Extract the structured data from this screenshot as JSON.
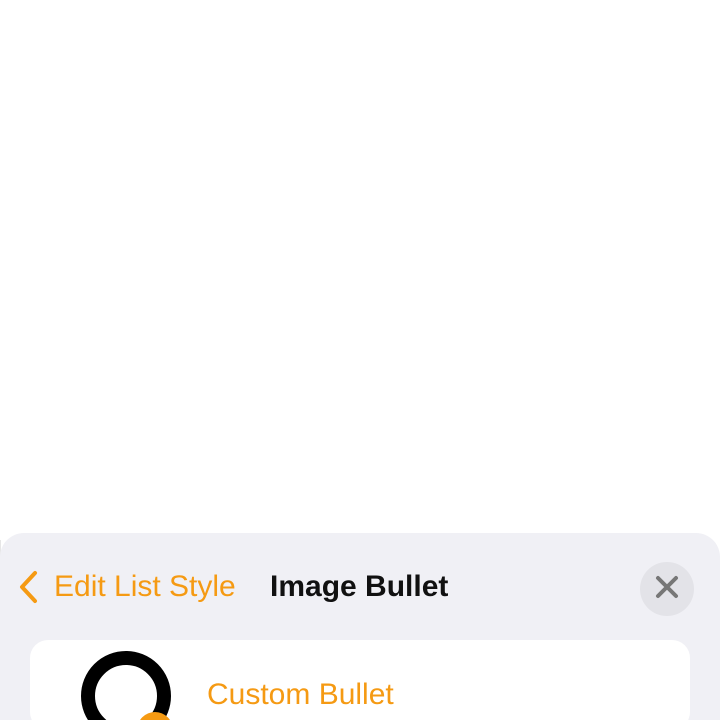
{
  "colors": {
    "accent": "#f59a13",
    "sheet_background": "#f0f0f5",
    "close_button_background": "#e3e3e8",
    "text_primary": "#111111"
  },
  "header": {
    "back_label": "Edit List Style",
    "title": "Image Bullet",
    "back_icon": "chevron-left-icon",
    "close_icon": "close-icon"
  },
  "options": [
    {
      "label": "Custom Bullet",
      "icon": "custom-bullet-preview-icon"
    }
  ]
}
